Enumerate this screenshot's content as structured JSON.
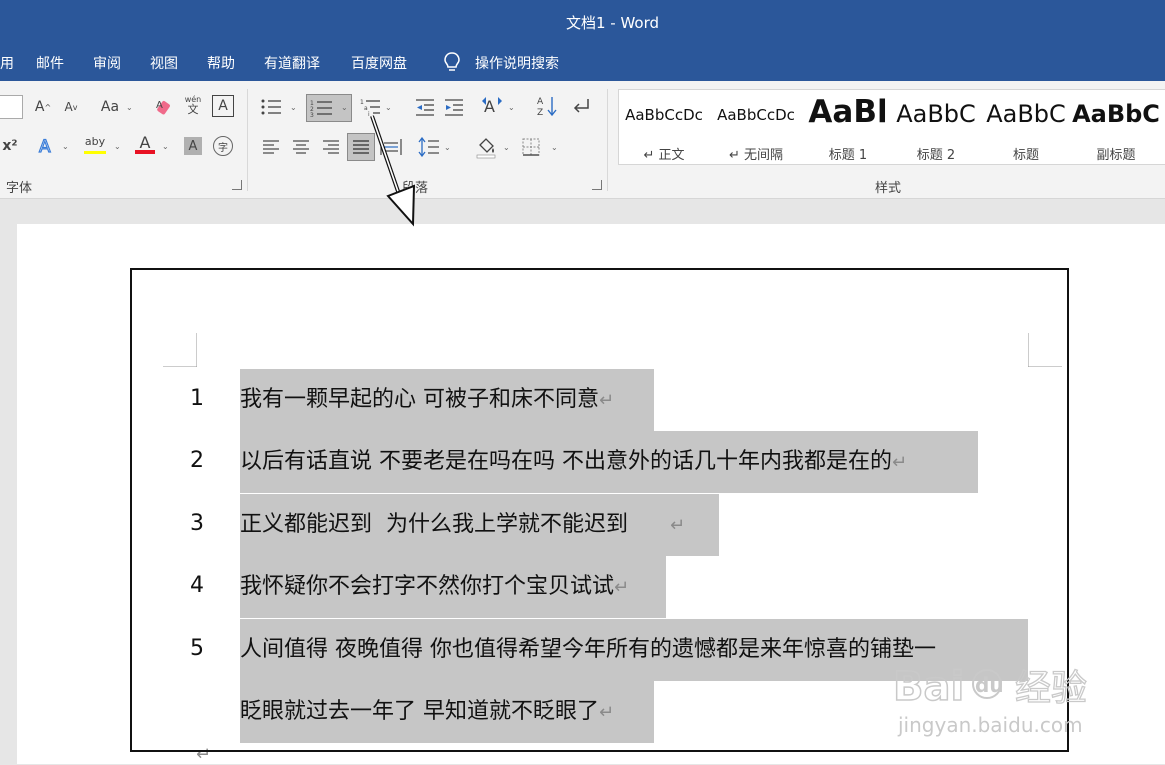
{
  "window": {
    "title": "文档1  -  Word"
  },
  "menu": {
    "items": [
      "用",
      "邮件",
      "审阅",
      "视图",
      "帮助",
      "有道翻译",
      "百度网盘",
      "操作说明搜索"
    ]
  },
  "ribbon": {
    "font_group": {
      "label": "字体"
    },
    "paragraph_group": {
      "label": "段落"
    },
    "styles_group": {
      "label": "样式"
    },
    "font_buttons": {
      "grow": "A",
      "shrink": "A",
      "case": "Aa",
      "pinyin": "文",
      "border_char": "A",
      "superscript": "x²",
      "text_effects": "A",
      "highlight": "aby",
      "font_color": "A",
      "char_shading": "A",
      "enclose": "字"
    },
    "styles": [
      {
        "sample": "AaBbCcDc",
        "name": "↵ 正文"
      },
      {
        "sample": "AaBbCcDc",
        "name": "↵ 无间隔"
      },
      {
        "sample": "AaBl",
        "name": "标题 1"
      },
      {
        "sample": "AaBbC",
        "name": "标题 2"
      },
      {
        "sample": "AaBbC",
        "name": "标题"
      },
      {
        "sample": "AaBbC",
        "name": "副标题"
      }
    ]
  },
  "document": {
    "lines": [
      {
        "num": "1",
        "text": "我有一颗早起的心  可被子和床不同意"
      },
      {
        "num": "2",
        "text": "以后有话直说  不要老是在吗在吗  不出意外的话几十年内我都是在的"
      },
      {
        "num": "3",
        "text": "正义都能迟到  为什么我上学就不能迟到      "
      },
      {
        "num": "4",
        "text": "我怀疑你不会打字不然你打个宝贝试试"
      },
      {
        "num": "5",
        "text": "人间值得  夜晚值得  你也值得希望今年所有的遗憾都是来年惊喜的铺垫一"
      },
      {
        "num": "",
        "text": "眨眼就过去一年了  早知道就不眨眼了"
      }
    ],
    "para_mark": "↵"
  },
  "watermark": {
    "brand": "Bai",
    "brand2": "du",
    "cn": "经验",
    "url": "jingyan.baidu.com"
  },
  "colors": {
    "titlebar": "#2b579a",
    "highlight": "#c6c6c6",
    "font_color_red": "#e81123"
  }
}
